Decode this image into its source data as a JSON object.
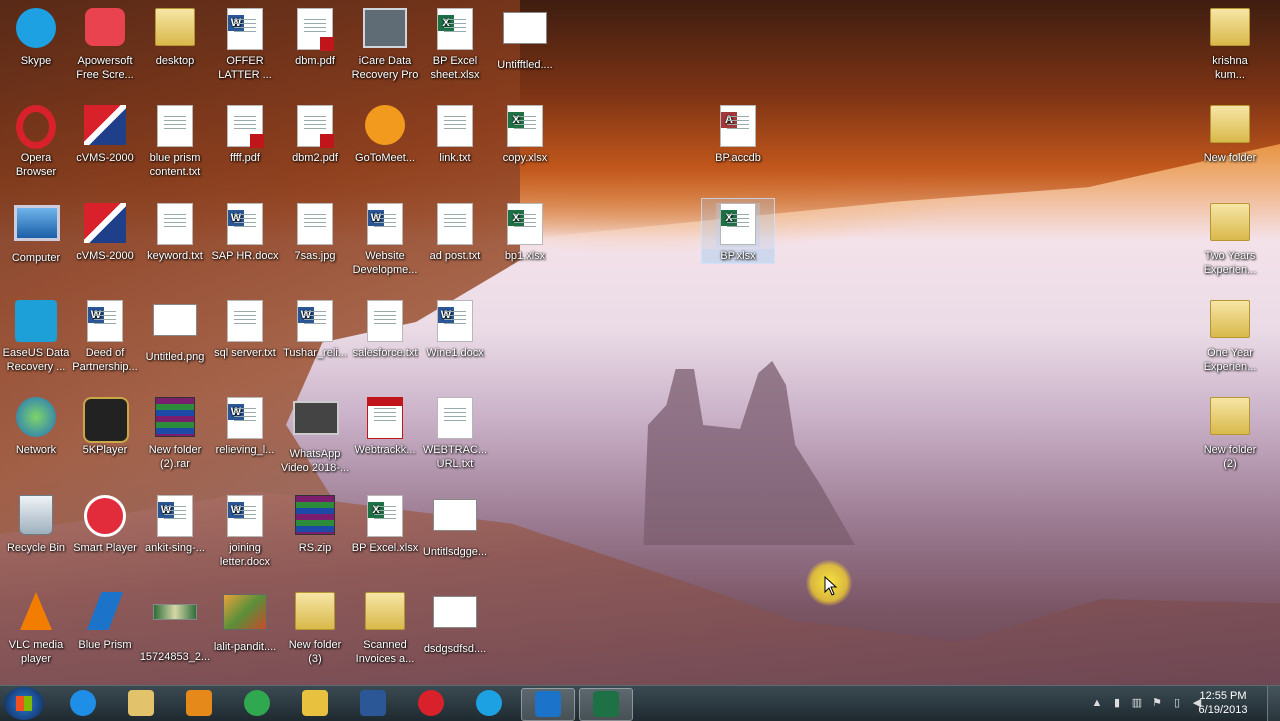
{
  "desktop": {
    "icons": [
      {
        "label": "Skype",
        "kind": "skype"
      },
      {
        "label": "Apowersoft\nFree Scre...",
        "kind": "apowersoft"
      },
      {
        "label": "desktop",
        "kind": "folder"
      },
      {
        "label": "OFFER\nLATTER ...",
        "kind": "word"
      },
      {
        "label": "dbm.pdf",
        "kind": "pdf"
      },
      {
        "label": "iCare Data\nRecovery Pro",
        "kind": "icare"
      },
      {
        "label": "BP Excel\nsheet.xlsx",
        "kind": "xls"
      },
      {
        "label": "Untifftled....",
        "kind": "image"
      },
      {
        "label": "krishna\nkum...",
        "kind": "folder"
      },
      {
        "label": "Opera\nBrowser",
        "kind": "opera"
      },
      {
        "label": "cVMS-2000",
        "kind": "cvms"
      },
      {
        "label": "blue prism\ncontent.txt",
        "kind": "txt"
      },
      {
        "label": "ffff.pdf",
        "kind": "pdf"
      },
      {
        "label": "dbm2.pdf",
        "kind": "pdf"
      },
      {
        "label": "GoToMeet...",
        "kind": "gotomeeting"
      },
      {
        "label": "link.txt",
        "kind": "txt"
      },
      {
        "label": "copy.xlsx",
        "kind": "xls"
      },
      {
        "label": "BP.accdb",
        "kind": "access"
      },
      {
        "label": "New folder",
        "kind": "folder"
      },
      {
        "label": "Computer",
        "kind": "computer"
      },
      {
        "label": "cVMS-2000",
        "kind": "cvms"
      },
      {
        "label": "keyword.txt",
        "kind": "txt"
      },
      {
        "label": "SAP HR.docx",
        "kind": "word"
      },
      {
        "label": "7sas.jpg",
        "kind": "doc"
      },
      {
        "label": "Website\nDevelopme...",
        "kind": "word"
      },
      {
        "label": "ad post.txt",
        "kind": "txt"
      },
      {
        "label": "bp1.xlsx",
        "kind": "xls"
      },
      {
        "label": "BP.xlsx",
        "kind": "xls"
      },
      {
        "label": "Two Years\nExperien...",
        "kind": "folder"
      },
      {
        "label": "EaseUS Data\nRecovery ...",
        "kind": "easeus"
      },
      {
        "label": "Deed of\nPartnership...",
        "kind": "word"
      },
      {
        "label": "Untitled.png",
        "kind": "image"
      },
      {
        "label": "sql server.txt",
        "kind": "txt"
      },
      {
        "label": "Tushar_reli...",
        "kind": "word"
      },
      {
        "label": "salesforce.txt",
        "kind": "txt"
      },
      {
        "label": "Wine1.docx",
        "kind": "word"
      },
      {
        "label": "One Year\nExperien...",
        "kind": "folder"
      },
      {
        "label": "Network",
        "kind": "network"
      },
      {
        "label": "5KPlayer",
        "kind": "5kplayer"
      },
      {
        "label": "New folder\n(2).rar",
        "kind": "zip"
      },
      {
        "label": "relieving_l...",
        "kind": "word"
      },
      {
        "label": "WhatsApp\nVideo 2018-...",
        "kind": "video"
      },
      {
        "label": "Webtrackk...",
        "kind": "pdfapp"
      },
      {
        "label": "WEBTRAC...\nURL.txt",
        "kind": "txt"
      },
      {
        "label": "New folder\n(2)",
        "kind": "folder"
      },
      {
        "label": "Recycle Bin",
        "kind": "recycle"
      },
      {
        "label": "Smart Player",
        "kind": "smartplayer"
      },
      {
        "label": "ankit-sing-...",
        "kind": "word"
      },
      {
        "label": "joining\nletter.docx",
        "kind": "word"
      },
      {
        "label": "RS.zip",
        "kind": "zip"
      },
      {
        "label": "BP Excel.xlsx",
        "kind": "xls"
      },
      {
        "label": "Untitlsdgge...",
        "kind": "image"
      },
      {
        "label": "VLC media\nplayer",
        "kind": "vlc"
      },
      {
        "label": "Blue Prism",
        "kind": "blueprism"
      },
      {
        "label": "15724853_2...",
        "kind": "imagesmall"
      },
      {
        "label": "lalit-pandit....",
        "kind": "photo"
      },
      {
        "label": "New folder\n(3)",
        "kind": "folder"
      },
      {
        "label": "Scanned\nInvoices a...",
        "kind": "folder"
      },
      {
        "label": "dsdgsdfsd....",
        "kind": "image"
      }
    ]
  },
  "taskbar": {
    "pinned": [
      {
        "name": "internet-explorer",
        "color": "#1f8ee6"
      },
      {
        "name": "windows-explorer",
        "color": "#e2c26a"
      },
      {
        "name": "media-player",
        "color": "#e58a1a"
      },
      {
        "name": "chrome",
        "color": "#2fa84f"
      },
      {
        "name": "outlook-mail",
        "color": "#e8c23e"
      },
      {
        "name": "word",
        "color": "#2b5797"
      },
      {
        "name": "opera",
        "color": "#d8212a"
      },
      {
        "name": "skype",
        "color": "#1da1e2"
      },
      {
        "name": "blue-prism",
        "color": "#1b74c9"
      },
      {
        "name": "excel",
        "color": "#1e7145"
      }
    ],
    "clock": {
      "time": "12:55 PM",
      "date": "6/19/2013"
    }
  },
  "colors": {
    "selection": "#a8c8ef",
    "cursor_highlight": "#ffe03c",
    "taskbar": "#1e2a30"
  }
}
